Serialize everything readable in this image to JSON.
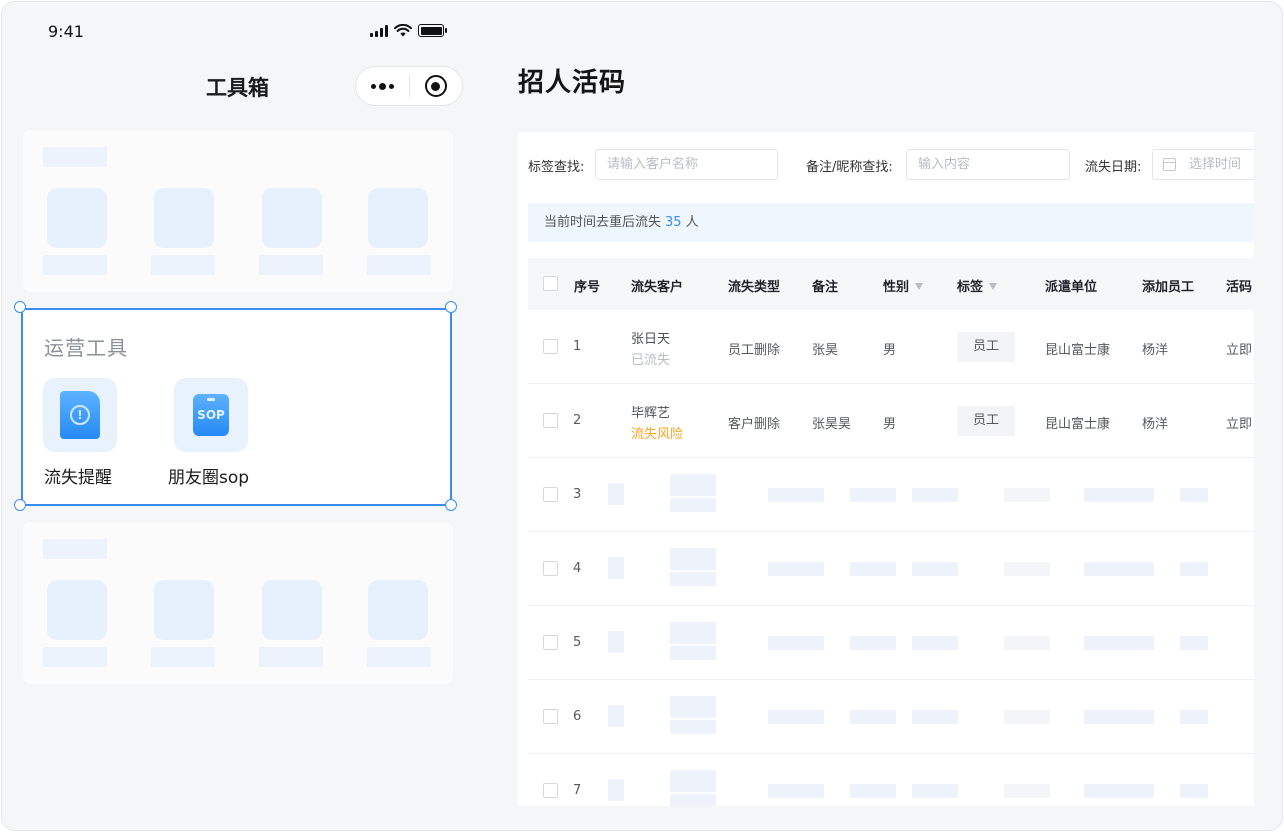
{
  "status_bar": {
    "time": "9:41"
  },
  "mini_program": {
    "nav_title": "工具箱",
    "menu_icon": "more-dots-icon",
    "close_icon": "target-circle-icon",
    "ops_section": {
      "title": "运营工具",
      "tools": [
        {
          "label": "流失提醒",
          "icon": "document-alert-icon"
        },
        {
          "label": "朋友圈sop",
          "icon": "sop-clipboard-icon"
        }
      ]
    }
  },
  "admin": {
    "page_title": "招人活码",
    "filters": {
      "tag_label": "标签查找:",
      "tag_placeholder": "请输入客户名称",
      "note_label": "备注/昵称查找:",
      "note_placeholder": "输入内容",
      "date_label": "流失日期:",
      "date_placeholder": "选择时间"
    },
    "notice": {
      "prefix": "当前时间去重后流失",
      "count": "35",
      "suffix": "人"
    },
    "columns": [
      "序号",
      "流失客户",
      "流失类型",
      "备注",
      "性别",
      "标签",
      "派遣单位",
      "添加员工",
      "活码"
    ],
    "rows": [
      {
        "index": "1",
        "customer": "张日天",
        "status": "已流失",
        "type": "员工删除",
        "note": "张昊",
        "gender": "男",
        "tag": "员工",
        "unit": "昆山富士康",
        "staff": "杨洋",
        "code": "立即"
      },
      {
        "index": "2",
        "customer": "毕辉艺",
        "status": "流失风险",
        "type": "客户删除",
        "note": "张昊昊",
        "gender": "男",
        "tag": "员工",
        "unit": "昆山富士康",
        "staff": "杨洋",
        "code": "立即"
      }
    ],
    "placeholder_rows": [
      "3",
      "4",
      "5",
      "6",
      "7"
    ],
    "colors": {
      "accent": "#3b8cf2",
      "warning": "#f5a623",
      "notice_bg": "#eef6fe"
    }
  }
}
